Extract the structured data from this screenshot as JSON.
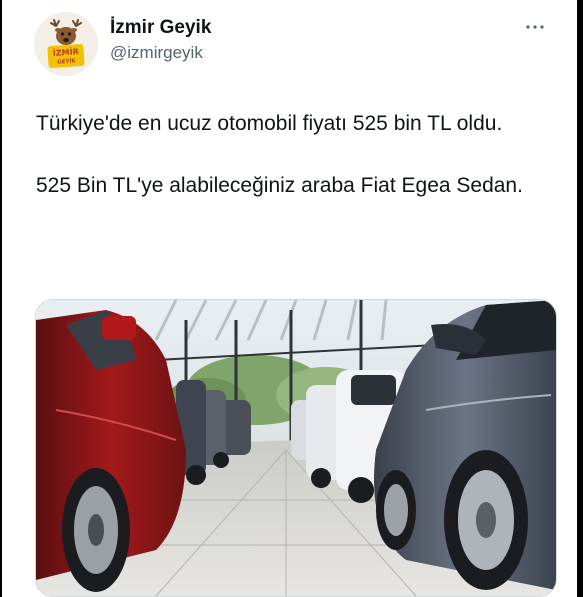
{
  "tweet": {
    "author": {
      "display_name": "İzmir Geyik",
      "handle": "@izmirgeyik",
      "avatar_text": "İZMİR GEYİK"
    },
    "text_paragraphs": [
      "Türkiye'de en ucuz otomobil fiyatı 525 bin TL oldu.",
      "525 Bin TL'ye alabileceğiniz araba Fiat Egea Sedan."
    ],
    "more_icon": "more-horizontal-icon",
    "media": {
      "description_icon": "car-showroom-photo"
    }
  },
  "colors": {
    "text_primary": "#0f1419",
    "text_secondary": "#536471",
    "border": "#cfd9de",
    "avatar_badge": "#f2c100"
  }
}
